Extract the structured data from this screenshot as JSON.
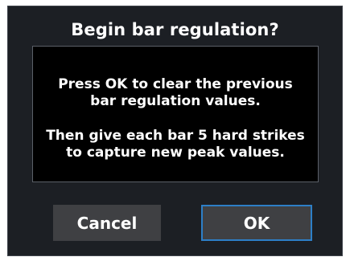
{
  "dialog": {
    "title": "Begin bar regulation?",
    "message_line_1a": "Press OK to clear the previous",
    "message_line_1b": "bar regulation values.",
    "message_line_2a": "Then give each bar 5 hard strikes",
    "message_line_2b": "to capture new peak values.",
    "cancel_label": "Cancel",
    "ok_label": "OK",
    "focused_button": "OK"
  },
  "colors": {
    "dialog_background": "#1c1f24",
    "message_background": "#000000",
    "button_background": "#3f4043",
    "focus_outline": "#2d7fc7",
    "text": "#ffffff"
  }
}
